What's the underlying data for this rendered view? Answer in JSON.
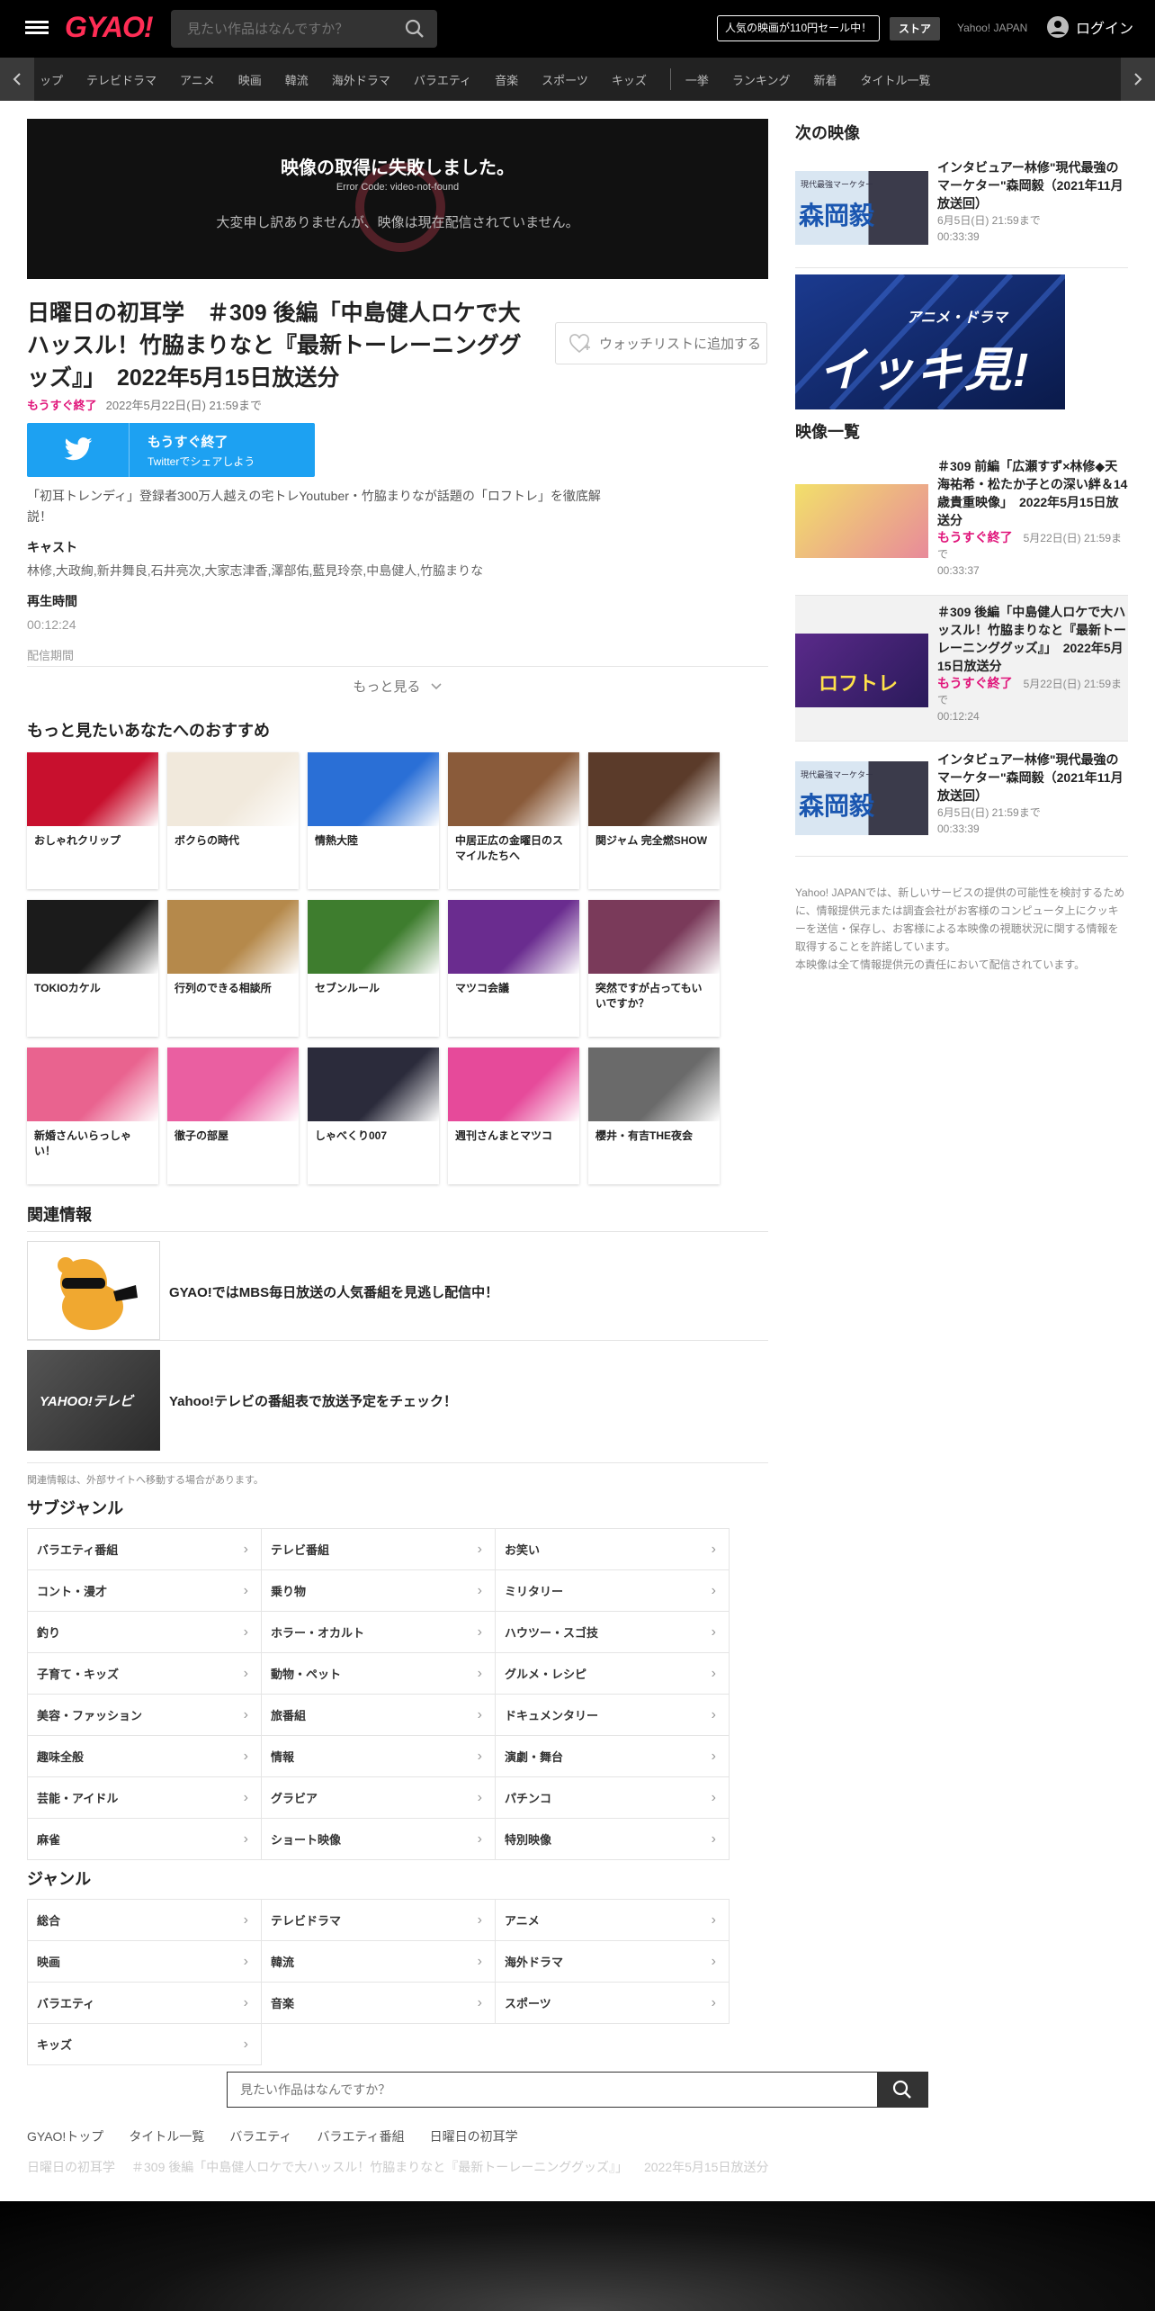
{
  "header": {
    "logo": "GYAO!",
    "search_placeholder": "見たい作品はなんですか？",
    "promo": "人気の映画が110円セール中！",
    "store": "ストア",
    "yahoo_japan": "Yahoo! JAPAN",
    "login": "ログイン"
  },
  "nav": {
    "items": [
      "ップ",
      "テレビドラマ",
      "アニメ",
      "映画",
      "韓流",
      "海外ドラマ",
      "バラエティ",
      "音楽",
      "スポーツ",
      "キッズ"
    ],
    "items2": [
      "一挙",
      "ランキング",
      "新着",
      "タイトル一覧"
    ]
  },
  "player": {
    "error_title": "映像の取得に失敗しました。",
    "error_code": "Error Code: video-not-found",
    "error_message": "大変申し訳ありませんが、映像は現在配信されていません。"
  },
  "episode": {
    "title": "日曜日の初耳学　＃309 後編「中島健人ロケで大ハッスル！竹脇まりなと『最新トーレーニンググッズ』」　2022年5月15日放送分",
    "watchlist": "ウォッチリストに追加する",
    "ending_soon": "もうすぐ終了",
    "until": "2022年5月22日(日) 21:59まで",
    "twitter_l1": "もうすぐ終了",
    "twitter_l2": "Twitterでシェアしよう",
    "description": "「初耳トレンディ」登録者300万人越えの宅トレYoutuber・竹脇まりなが話題の「ロフトレ」を徹底解説！",
    "cast_label": "キャスト",
    "cast": "林修,大政絢,新井舞良,石井亮次,大家志津香,澤部佑,藍見玲奈,中島健人,竹脇まりな",
    "duration_label": "再生時間",
    "duration": "00:12:24",
    "period_label": "配信期間",
    "more": "もっと見る"
  },
  "recommend": {
    "heading": "もっと見たいあなたへのおすすめ",
    "items": [
      {
        "title": "おしゃれクリップ",
        "color": "#c8102e"
      },
      {
        "title": "ボクらの時代",
        "color": "#f1e9dc"
      },
      {
        "title": "情熱大陸",
        "color": "#2a6fd6"
      },
      {
        "title": "中居正広の金曜日のスマイルたちへ",
        "color": "#8a5b3a"
      },
      {
        "title": "関ジャム 完全燃SHOW",
        "color": "#5b3b2a"
      },
      {
        "title": "TOKIOカケル",
        "color": "#1b1b1b"
      },
      {
        "title": "行列のできる相談所",
        "color": "#b5894b"
      },
      {
        "title": "セブンルール",
        "color": "#3e7d2e"
      },
      {
        "title": "マツコ会議",
        "color": "#6a2c8f"
      },
      {
        "title": "突然ですが占ってもいいですか？",
        "color": "#7a3a5a"
      },
      {
        "title": "新婚さんいらっしゃい！",
        "color": "#e9638f"
      },
      {
        "title": "徹子の部屋",
        "color": "#ea5fa1"
      },
      {
        "title": "しゃべくり007",
        "color": "#2b2b3b"
      },
      {
        "title": "週刊さんまとマツコ",
        "color": "#e64a9a"
      },
      {
        "title": "櫻井・有吉THE夜会",
        "color": "#6a6a6a"
      }
    ]
  },
  "related": {
    "heading": "関連情報",
    "items": [
      {
        "text": "GYAO!ではMBS毎日放送の人気番組を見逃し配信中！"
      },
      {
        "text": "Yahoo!テレビの番組表で放送予定をチェック！",
        "thumb_text": "YAHOO!テレビ"
      }
    ],
    "note": "関連情報は、外部サイトへ移動する場合があります。"
  },
  "subgenre": {
    "heading": "サブジャンル",
    "items": [
      "バラエティ番組",
      "テレビ番組",
      "お笑い",
      "コント・漫才",
      "乗り物",
      "ミリタリー",
      "釣り",
      "ホラー・オカルト",
      "ハウツー・スゴ技",
      "子育て・キッズ",
      "動物・ペット",
      "グルメ・レシピ",
      "美容・ファッション",
      "旅番組",
      "ドキュメンタリー",
      "趣味全般",
      "情報",
      "演劇・舞台",
      "芸能・アイドル",
      "グラビア",
      "パチンコ",
      "麻雀",
      "ショート映像",
      "特別映像"
    ]
  },
  "genre": {
    "heading": "ジャンル",
    "items": [
      "総合",
      "テレビドラマ",
      "アニメ",
      "映画",
      "韓流",
      "海外ドラマ",
      "バラエティ",
      "音楽",
      "スポーツ",
      "キッズ"
    ]
  },
  "footer": {
    "search_placeholder": "見たい作品はなんですか？",
    "links": [
      "GYAO!トップ",
      "タイトル一覧",
      "バラエティ",
      "バラエティ番組",
      "日曜日の初耳学"
    ],
    "crumbs": [
      "日曜日の初耳学",
      "＃309 後編「中島健人ロケで大ハッスル！竹脇まりなと『最新トーレーニンググッズ』」",
      "2022年5月15日放送分"
    ]
  },
  "sidebar": {
    "next_heading": "次の映像",
    "next": {
      "title": "インタビュアー林修\"現代最強のマーケター\"森岡毅（2021年11月放送回）",
      "until": "6月5日(日) 21:59まで",
      "duration": "00:33:39",
      "thumb_label": "現代最強マーケター",
      "thumb_name": "森岡毅"
    },
    "banner_small": "アニメ・ドラマ",
    "banner_big": "イッキ見!",
    "list_heading": "映像一覧",
    "list": [
      {
        "title": "＃309 前編「広瀬すず×林修◆天海祐希・松たか子との深い絆＆14歳貴重映像」　2022年5月15日放送分",
        "badge": "もうすぐ終了",
        "until": "5月22日(日) 21:59まで",
        "duration": "00:33:37"
      },
      {
        "title": "＃309 後編「中島健人ロケで大ハッスル！竹脇まりなと『最新トーレーニンググッズ』」　2022年5月15日放送分",
        "badge": "もうすぐ終了",
        "until": "5月22日(日) 21:59まで",
        "duration": "00:12:24",
        "thumb_text": "ロフトレ"
      },
      {
        "title": "インタビュアー林修\"現代最強のマーケター\"森岡毅（2021年11月放送回）",
        "until": "6月5日(日) 21:59まで",
        "duration": "00:33:39",
        "thumb_label": "現代最強マーケター",
        "thumb_name": "森岡毅"
      }
    ],
    "note1": "Yahoo! JAPANでは、新しいサービスの提供の可能性を検討するために、情報提供元または調査会社がお客様のコンピュータ上にクッキーを送信・保存し、お客様による本映像の視聴状況に関する情報を取得することを許諾しています。",
    "note2": "本映像は全て情報提供元の責任において配信されています。"
  },
  "colors": {
    "accent": "#e0147a",
    "twitter": "#1da1f2",
    "logo": "#ff2d55"
  }
}
